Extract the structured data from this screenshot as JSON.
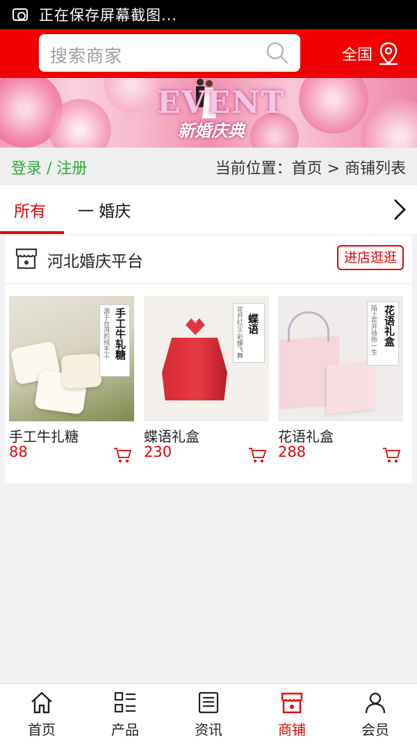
{
  "status_bar": {
    "text": "正在保存屏幕截图..."
  },
  "header": {
    "search_placeholder": "搜索商家",
    "region_label": "全国",
    "brand_color": "#f00000"
  },
  "banner": {
    "title_text": "EVENT",
    "subtitle_text": "新婚庆典"
  },
  "breadcrumb_bar": {
    "login_label": "登录 / 注册",
    "location_text": "当前位置：首页 > 商铺列表"
  },
  "tabs": {
    "all_label": "所有",
    "category_label": "一 婚庆"
  },
  "shop": {
    "name": "河北婚庆平台",
    "visit_label": "进店逛逛",
    "products": [
      {
        "name": "手工牛扎糖",
        "price": "88",
        "tag_big": "手工牛轧糖",
        "tag_small": "源于台湾的纯手工"
      },
      {
        "name": "蝶语礼盒",
        "price": "230",
        "tag_big": "蝶语",
        "tag_small": "花开红尘·彩蝶飞舞"
      },
      {
        "name": "花语礼盒",
        "price": "288",
        "tag_big": "花语礼盒",
        "tag_small": "陌上花开待你一生"
      }
    ]
  },
  "bottom_nav": [
    {
      "label": "首页",
      "icon": "home-icon"
    },
    {
      "label": "产品",
      "icon": "list-icon"
    },
    {
      "label": "资讯",
      "icon": "news-icon"
    },
    {
      "label": "商铺",
      "icon": "shop-icon",
      "active": true
    },
    {
      "label": "会员",
      "icon": "user-icon"
    }
  ],
  "colors": {
    "accent": "#e60000",
    "login_green": "#2eaa3a"
  }
}
